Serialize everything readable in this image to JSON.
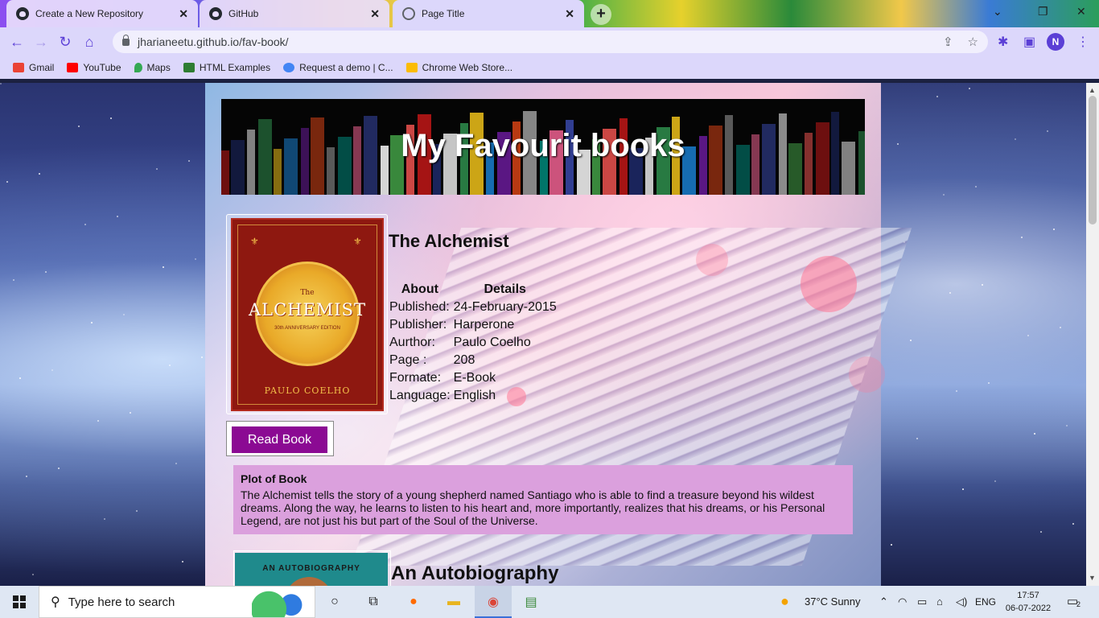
{
  "browser": {
    "tabs": [
      {
        "title": "Create a New Repository",
        "icon": "github-icon"
      },
      {
        "title": "GitHub",
        "icon": "github-icon"
      },
      {
        "title": "Page Title",
        "icon": "globe-icon"
      }
    ],
    "url": "jharianeetu.github.io/fav-book/",
    "profile_initial": "N",
    "bookmarks": [
      {
        "label": "Gmail",
        "color": "#ea4335"
      },
      {
        "label": "YouTube",
        "color": "#ff0000"
      },
      {
        "label": "Maps",
        "color": "#34a853"
      },
      {
        "label": "HTML Examples",
        "color": "#2e7d32"
      },
      {
        "label": "Request a demo | C...",
        "color": "#4285f4"
      },
      {
        "label": "Chrome Web Store...",
        "color": "#fbbc05"
      }
    ]
  },
  "page": {
    "banner_title": "My Favourit books",
    "book1": {
      "cover_the": "The",
      "cover_title": "ALCHEMIST",
      "cover_edition": "30th ANNIVERSARY EDITION",
      "cover_author": "PAULO COELHO",
      "title": "The Alchemist",
      "table_headers": [
        "About",
        "Details"
      ],
      "rows": [
        [
          "Published:",
          "24-February-2015"
        ],
        [
          "Publisher:",
          "Harperone"
        ],
        [
          "Aurthor:",
          "Paulo Coelho"
        ],
        [
          "Page :",
          "208"
        ],
        [
          "Formate:",
          "E-Book"
        ],
        [
          "Language:",
          "English"
        ]
      ],
      "button": "Read Book",
      "plot_heading": "Plot of Book",
      "plot_text": "The Alchemist tells the story of a young shepherd named Santiago who is able to find a treasure beyond his wildest dreams. Along the way, he learns to listen to his heart and, more importantly, realizes that his dreams, or his Personal Legend, are not just his but part of the Soul of the Universe."
    },
    "book2": {
      "cover_text": "AN AUTOBIOGRAPHY",
      "title": "An Autobiography"
    }
  },
  "taskbar": {
    "search_placeholder": "Type here to search",
    "weather": "37°C  Sunny",
    "language": "ENG",
    "time": "17:57",
    "date": "06-07-2022",
    "notifications": "2"
  }
}
